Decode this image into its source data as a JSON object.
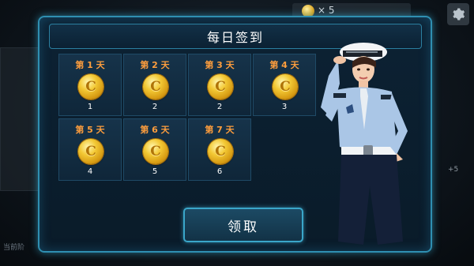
{
  "background": {
    "top_counter": "× 5",
    "side_text": "当前阶",
    "side_plus": "+5"
  },
  "dialog": {
    "title": "每日签到",
    "claim_button": "领取"
  },
  "days": [
    {
      "label": "第 1 天",
      "amount": "1"
    },
    {
      "label": "第 2 天",
      "amount": "2"
    },
    {
      "label": "第 3 天",
      "amount": "2"
    },
    {
      "label": "第 4 天",
      "amount": "3"
    },
    {
      "label": "第 5 天",
      "amount": "4"
    },
    {
      "label": "第 6 天",
      "amount": "5"
    },
    {
      "label": "第 7 天",
      "amount": "6"
    }
  ],
  "coin_symbol": "C",
  "colors": {
    "accent_border": "#2f8fb1",
    "day_label": "#ff9e3d",
    "coin_gold": "#f3c935"
  },
  "icons": [
    "gear-icon",
    "coin-icon",
    "police-officer-character"
  ]
}
